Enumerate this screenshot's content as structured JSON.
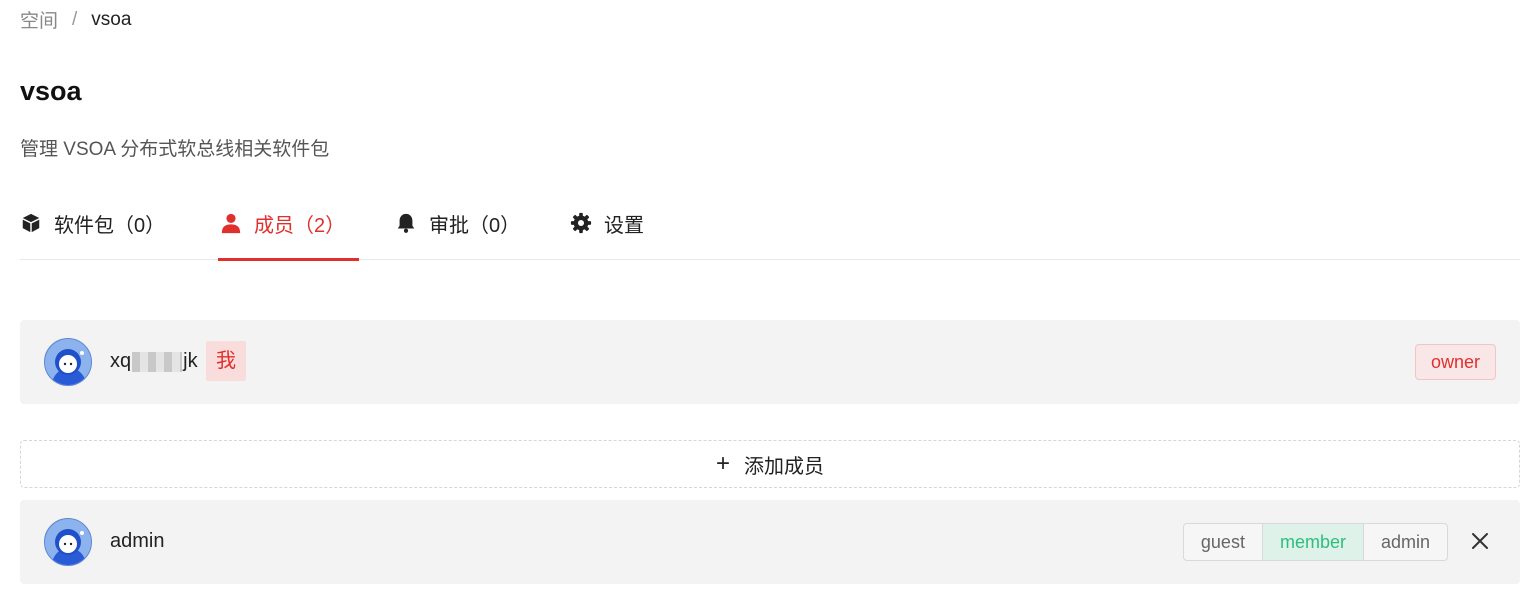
{
  "breadcrumb": {
    "root": "空间",
    "separator": "/",
    "current": "vsoa"
  },
  "space": {
    "title": "vsoa",
    "description": "管理 VSOA 分布式软总线相关软件包"
  },
  "tabs": [
    {
      "label": "软件包（0）",
      "icon": "package-icon"
    },
    {
      "label": "成员（2）",
      "icon": "user-icon",
      "active": true
    },
    {
      "label": "审批（0）",
      "icon": "bell-icon"
    },
    {
      "label": "设置",
      "icon": "gear-icon"
    }
  ],
  "members": [
    {
      "name_start": "xq",
      "name_end": "jk",
      "me_badge": "我",
      "role": "owner"
    },
    {
      "name": "admin",
      "roles": [
        "guest",
        "member",
        "admin"
      ],
      "selected_role": "member"
    }
  ],
  "add_member": {
    "label": "添加成员"
  },
  "colors": {
    "accent": "#e0302e",
    "selected_role": "#2ebd7e",
    "card_bg": "#f3f3f3"
  }
}
